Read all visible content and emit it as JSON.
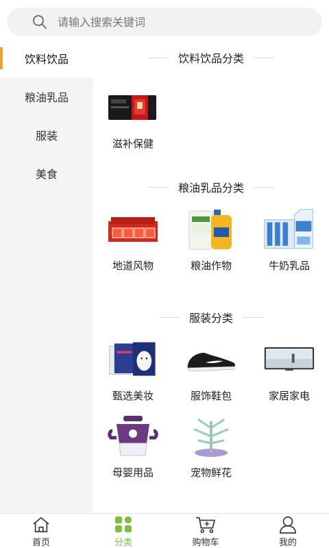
{
  "search": {
    "placeholder": "请输入搜索关键词"
  },
  "sidebar": {
    "items": [
      {
        "label": "饮料饮品",
        "active": true
      },
      {
        "label": "粮油乳品",
        "active": false
      },
      {
        "label": "服装",
        "active": false
      },
      {
        "label": "美食",
        "active": false
      }
    ]
  },
  "sections": [
    {
      "title": "饮料饮品分类",
      "items": [
        {
          "label": "滋补保健",
          "icon": "tonic-gift-box-image"
        }
      ]
    },
    {
      "title": "粮油乳品分类",
      "items": [
        {
          "label": "地道风物",
          "icon": "red-gift-box-image"
        },
        {
          "label": "粮油作物",
          "icon": "rice-and-oil-image"
        },
        {
          "label": "牛奶乳品",
          "icon": "milk-carton-image"
        }
      ]
    },
    {
      "title": "服装分类",
      "items": [
        {
          "label": "甄选美妆",
          "icon": "face-mask-pack-image"
        },
        {
          "label": "服饰鞋包",
          "icon": "sneaker-image"
        },
        {
          "label": "家居家电",
          "icon": "television-image"
        },
        {
          "label": "母婴用品",
          "icon": "baby-sippy-cup-image"
        },
        {
          "label": "宠物鲜花",
          "icon": "bottle-drying-rack-image"
        }
      ]
    }
  ],
  "tabbar": {
    "items": [
      {
        "label": "首页",
        "icon": "home-icon",
        "active": false
      },
      {
        "label": "分类",
        "icon": "category-grid-icon",
        "active": true
      },
      {
        "label": "购物车",
        "icon": "cart-icon",
        "active": false
      },
      {
        "label": "我的",
        "icon": "user-icon",
        "active": false
      }
    ]
  },
  "colors": {
    "accent": "#f0a030",
    "tab_active": "#7cbf3a",
    "sidebar_bg": "#f4f4f4"
  }
}
